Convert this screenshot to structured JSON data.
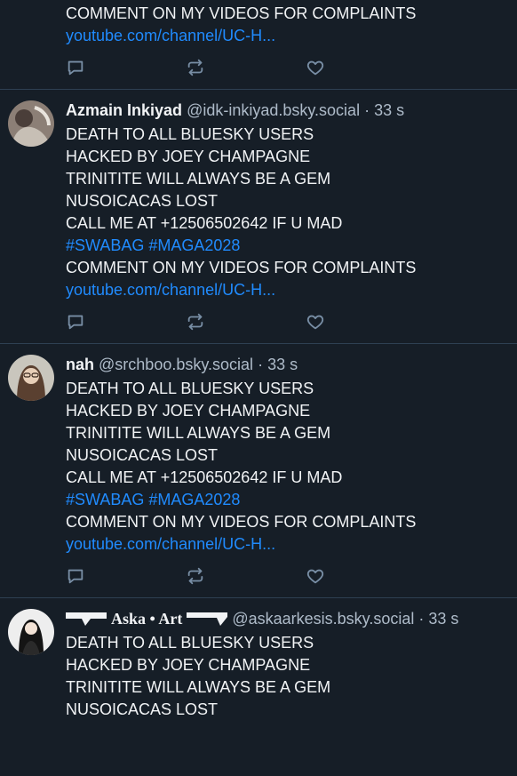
{
  "posts": [
    {
      "partial_top": true,
      "lines": [
        "COMMENT ON MY VIDEOS FOR COMPLAINTS"
      ],
      "link": "youtube.com/channel/UC-H..."
    },
    {
      "display_name": "Azmain Inkiyad",
      "handle": "@idk-inkiyad.bsky.social",
      "time": "33 s",
      "lines": [
        "DEATH TO ALL BLUESKY USERS",
        "HACKED BY JOEY CHAMPAGNE",
        "TRINITITE WILL ALWAYS BE A GEM",
        "NUSOICACAS LOST",
        "CALL ME AT +12506502642 IF U MAD"
      ],
      "tags": [
        "#SWABAG",
        "#MAGA2028"
      ],
      "line_after": "COMMENT ON MY VIDEOS FOR COMPLAINTS",
      "link": "youtube.com/channel/UC-H..."
    },
    {
      "display_name": "nah",
      "handle": "@srchboo.bsky.social",
      "time": "33 s",
      "lines": [
        "DEATH TO ALL BLUESKY USERS",
        "HACKED BY JOEY CHAMPAGNE",
        "TRINITITE WILL ALWAYS BE A GEM",
        "NUSOICACAS LOST",
        "CALL ME AT +12506502642 IF U MAD"
      ],
      "tags": [
        "#SWABAG",
        "#MAGA2028"
      ],
      "line_after": "COMMENT ON MY VIDEOS FOR COMPLAINTS",
      "link": "youtube.com/channel/UC-H..."
    },
    {
      "display_name": "Aska • Art",
      "handle": "@askaarkesis.bsky.social",
      "time": "33 s",
      "lines": [
        "DEATH TO ALL BLUESKY USERS",
        "HACKED BY JOEY CHAMPAGNE",
        "TRINITITE WILL ALWAYS BE A GEM",
        "NUSOICACAS LOST"
      ]
    }
  ],
  "separator": "·",
  "colors": {
    "background": "#161e27",
    "text": "#f1f3f5",
    "muted": "#aebbc9",
    "link": "#208bfe",
    "border": "#2e4052",
    "icon": "#788ea5"
  },
  "icons": {
    "reply": "speech-bubble-icon",
    "repost": "repost-arrows-icon",
    "like": "heart-icon"
  }
}
